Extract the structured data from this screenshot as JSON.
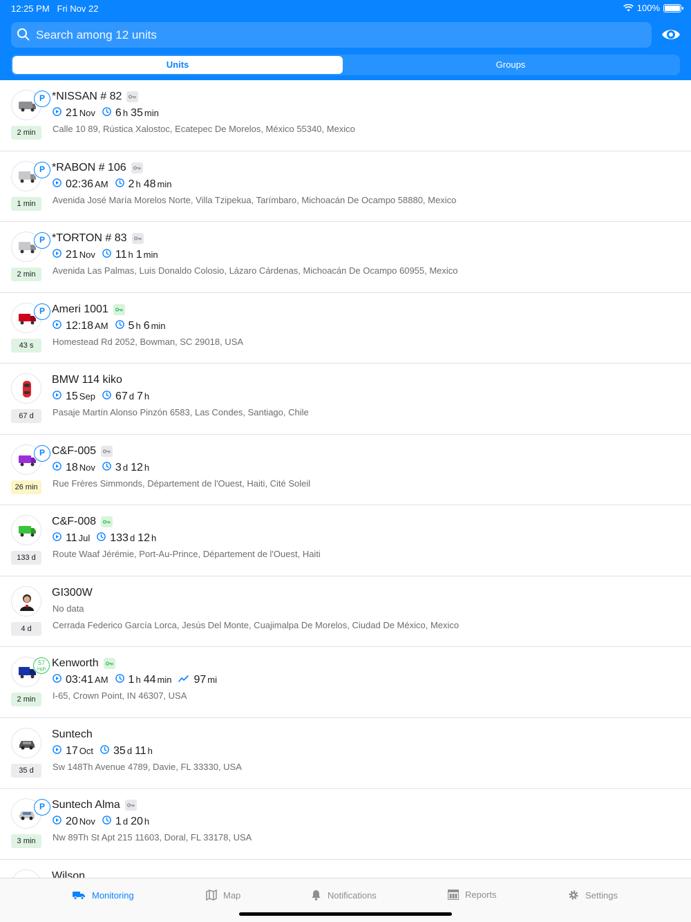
{
  "status_bar": {
    "time": "12:25 PM",
    "date": "Fri Nov 22",
    "battery": "100%"
  },
  "search": {
    "placeholder": "Search among 12 units"
  },
  "tabs": [
    {
      "label": "Units",
      "active": true
    },
    {
      "label": "Groups",
      "active": false
    }
  ],
  "units": [
    {
      "name": "*NISSAN # 82",
      "icon": "van-icon",
      "badge": "P",
      "key": "gray",
      "age": "2 min",
      "age_color": "green",
      "info": [
        {
          "icon": "play-icon",
          "value": "21",
          "unit": "Nov"
        },
        {
          "icon": "clock-icon",
          "value": "6",
          "unit": "h",
          "value2": "35",
          "unit2": "min"
        }
      ],
      "address": "Calle 10 89, Rústica Xalostoc, Ecatepec De Morelos, México 55340, Mexico"
    },
    {
      "name": "*RABON # 106",
      "icon": "truck-icon",
      "badge": "P",
      "key": "gray",
      "age": "1 min",
      "age_color": "green",
      "info": [
        {
          "icon": "play-icon",
          "value": "02:36",
          "unit": "AM"
        },
        {
          "icon": "clock-icon",
          "value": "2",
          "unit": "h",
          "value2": "48",
          "unit2": "min"
        }
      ],
      "address": "Avenida José María Morelos Norte, Villa Tzipekua, Tarímbaro, Michoacán De Ocampo 58880, Mexico"
    },
    {
      "name": "*TORTON # 83",
      "icon": "truck-icon",
      "badge": "P",
      "key": "gray",
      "age": "2 min",
      "age_color": "green",
      "info": [
        {
          "icon": "play-icon",
          "value": "21",
          "unit": "Nov"
        },
        {
          "icon": "clock-icon",
          "value": "11",
          "unit": "h",
          "value2": "1",
          "unit2": "min"
        }
      ],
      "address": "Avenida Las Palmas, Luis Donaldo Colosio, Lázaro Cárdenas, Michoacán De Ocampo 60955, Mexico"
    },
    {
      "name": "Ameri 1001",
      "icon": "red-truck-icon",
      "badge": "P",
      "key": "green",
      "age": "43 s",
      "age_color": "green",
      "info": [
        {
          "icon": "play-icon",
          "value": "12:18",
          "unit": "AM"
        },
        {
          "icon": "clock-icon",
          "value": "5",
          "unit": "h",
          "value2": "6",
          "unit2": "min"
        }
      ],
      "address": "Homestead Rd 2052, Bowman, SC 29018, USA"
    },
    {
      "name": "BMW 114 kiko",
      "icon": "red-car-icon",
      "badge": "",
      "key": "",
      "age": "67 d",
      "age_color": "gray",
      "info": [
        {
          "icon": "play-icon",
          "value": "15",
          "unit": "Sep"
        },
        {
          "icon": "clock-icon",
          "value": "67",
          "unit": "d",
          "value2": "7",
          "unit2": "h"
        }
      ],
      "address": "Pasaje Martín Alonso Pinzón 6583, Las Condes, Santiago, Chile"
    },
    {
      "name": "C&F-005",
      "icon": "purple-truck-icon",
      "badge": "P",
      "key": "gray",
      "age": "26 min",
      "age_color": "yellow",
      "info": [
        {
          "icon": "play-icon",
          "value": "18",
          "unit": "Nov"
        },
        {
          "icon": "clock-icon",
          "value": "3",
          "unit": "d",
          "value2": "12",
          "unit2": "h"
        }
      ],
      "address": "Rue Frères Simmonds, Département de l'Ouest, Haiti, Cité Soleil"
    },
    {
      "name": "C&F-008",
      "icon": "green-truck-icon",
      "badge": "",
      "key": "green",
      "age": "133 d",
      "age_color": "gray",
      "info": [
        {
          "icon": "play-icon",
          "value": "11",
          "unit": "Jul"
        },
        {
          "icon": "clock-icon",
          "value": "133",
          "unit": "d",
          "value2": "12",
          "unit2": "h"
        }
      ],
      "address": "Route Waaf Jérémie, Port-Au-Prince, Département de l'Ouest, Haiti"
    },
    {
      "name": "GI300W",
      "icon": "person-icon",
      "badge": "",
      "key": "",
      "age": "4 d",
      "age_color": "gray",
      "nodata": "No data",
      "address": "Cerrada Federico García Lorca, Jesús Del Monte, Cuajimalpa De Morelos, Ciudad De México, Mexico"
    },
    {
      "name": "Kenworth",
      "icon": "blue-truck-icon",
      "badge": "speed",
      "speed": "57",
      "speed_unit": "mph",
      "key": "green",
      "age": "2 min",
      "age_color": "green",
      "info": [
        {
          "icon": "play-icon",
          "value": "03:41",
          "unit": "AM"
        },
        {
          "icon": "clock-icon",
          "value": "1",
          "unit": "h",
          "value2": "44",
          "unit2": "min"
        },
        {
          "icon": "trend-icon",
          "value": "97",
          "unit": "mi"
        }
      ],
      "address": "I-65, Crown Point, IN 46307, USA"
    },
    {
      "name": "Suntech",
      "icon": "gray-car-icon",
      "badge": "",
      "key": "",
      "age": "35 d",
      "age_color": "gray",
      "info": [
        {
          "icon": "play-icon",
          "value": "17",
          "unit": "Oct"
        },
        {
          "icon": "clock-icon",
          "value": "35",
          "unit": "d",
          "value2": "11",
          "unit2": "h"
        }
      ],
      "address": "Sw 148Th Avenue 4789, Davie, FL 33330, USA"
    },
    {
      "name": "Suntech Alma",
      "icon": "silver-car-icon",
      "badge": "P",
      "key": "gray",
      "age": "3 min",
      "age_color": "green",
      "info": [
        {
          "icon": "play-icon",
          "value": "20",
          "unit": "Nov"
        },
        {
          "icon": "clock-icon",
          "value": "1",
          "unit": "d",
          "value2": "20",
          "unit2": "h"
        }
      ],
      "address": "Nw 89Th St Apt 215 11603, Doral, FL 33178, USA"
    },
    {
      "name": "Wilson",
      "icon": "person-icon",
      "badge": "",
      "key": "",
      "age": "",
      "age_color": "gray",
      "address": ""
    }
  ],
  "bottom_tabs": [
    {
      "label": "Monitoring",
      "icon": "truck-tab-icon",
      "active": true
    },
    {
      "label": "Map",
      "icon": "map-icon",
      "active": false
    },
    {
      "label": "Notifications",
      "icon": "bell-icon",
      "active": false
    },
    {
      "label": "Reports",
      "icon": "reports-icon",
      "active": false
    },
    {
      "label": "Settings",
      "icon": "gear-icon",
      "active": false
    }
  ],
  "colors": {
    "accent": "#0a84ff",
    "online_green": "#34c759"
  }
}
